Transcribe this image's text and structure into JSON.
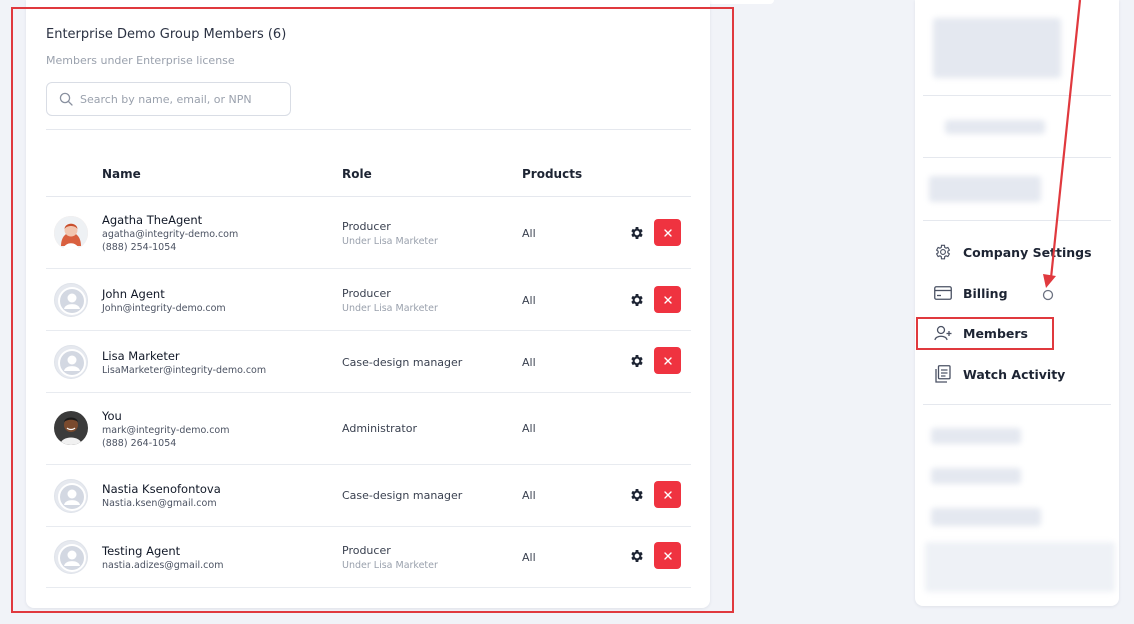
{
  "members_panel": {
    "title": "Enterprise Demo Group Members (6)",
    "subtitle": "Members under Enterprise license",
    "search_placeholder": "Search by name, email, or NPN",
    "columns": {
      "name": "Name",
      "role": "Role",
      "products": "Products"
    },
    "rows": [
      {
        "name": "Agatha TheAgent",
        "email": "agatha@integrity-demo.com",
        "phone": "(888) 254-1054",
        "role": "Producer",
        "role_sub": "Under Lisa Marketer",
        "products": "All",
        "avatar": "photo-woman",
        "actions": true
      },
      {
        "name": "John Agent",
        "email": "John@integrity-demo.com",
        "phone": "",
        "role": "Producer",
        "role_sub": "Under Lisa Marketer",
        "products": "All",
        "avatar": "default-user-icon",
        "actions": true
      },
      {
        "name": "Lisa Marketer",
        "email": "LisaMarketer@integrity-demo.com",
        "phone": "",
        "role": "Case-design manager",
        "role_sub": "",
        "products": "All",
        "avatar": "default-user-icon",
        "actions": true
      },
      {
        "name": "You",
        "email": "mark@integrity-demo.com",
        "phone": "(888) 264-1054",
        "role": "Administrator",
        "role_sub": "",
        "products": "All",
        "avatar": "photo-man",
        "actions": false
      },
      {
        "name": "Nastia Ksenofontova",
        "email": "Nastia.ksen@gmail.com",
        "phone": "",
        "role": "Case-design manager",
        "role_sub": "",
        "products": "All",
        "avatar": "default-user-icon",
        "actions": true
      },
      {
        "name": "Testing Agent",
        "email": "nastia.adizes@gmail.com",
        "phone": "",
        "role": "Producer",
        "role_sub": "Under Lisa Marketer",
        "products": "All",
        "avatar": "default-user-icon",
        "actions": true
      }
    ]
  },
  "sidebar": {
    "items": [
      {
        "label": "Company Settings",
        "icon": "gear-outline-icon"
      },
      {
        "label": "Billing",
        "icon": "credit-card-icon"
      },
      {
        "label": "Members",
        "icon": "add-user-icon"
      },
      {
        "label": "Watch Activity",
        "icon": "clipboard-icon"
      }
    ]
  },
  "colors": {
    "annotation_red": "#e0393e",
    "delete_red": "#ef3340",
    "background": "#f1f3f8"
  }
}
